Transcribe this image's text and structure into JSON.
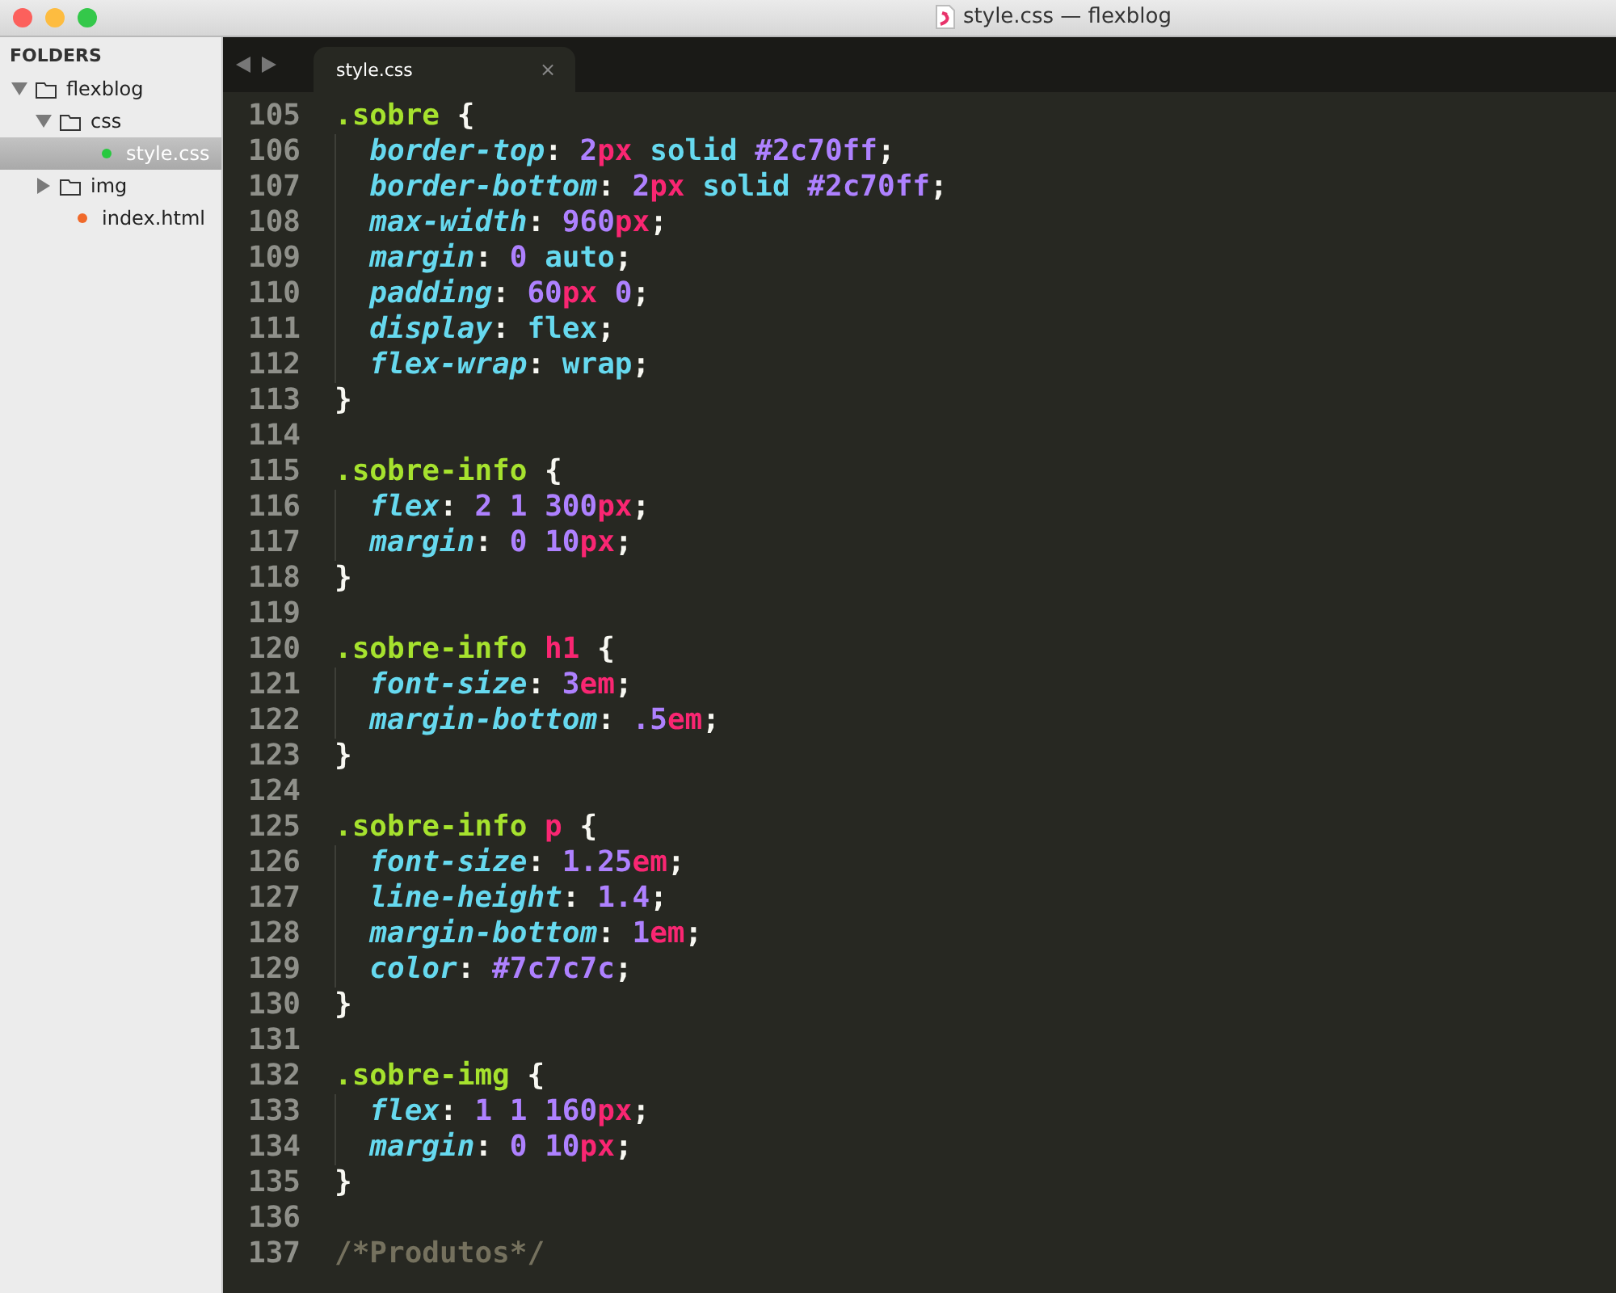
{
  "window": {
    "title": "style.css — flexblog"
  },
  "sidebar": {
    "heading": "FOLDERS",
    "items": [
      {
        "kind": "folder",
        "name": "flexblog",
        "expanded": true,
        "selected": false,
        "children": [
          {
            "kind": "folder",
            "name": "css",
            "expanded": true,
            "selected": false,
            "children": [
              {
                "kind": "file",
                "name": "style.css",
                "selected": true,
                "color": "#27c93f"
              }
            ]
          },
          {
            "kind": "folder",
            "name": "img",
            "expanded": false,
            "selected": false
          },
          {
            "kind": "file",
            "name": "index.html",
            "selected": false,
            "color": "#f0692a"
          }
        ]
      }
    ]
  },
  "tabs": [
    {
      "label": "style.css",
      "selected": true,
      "close": "×"
    }
  ],
  "editor": {
    "lines": [
      {
        "number": "105",
        "tokens": [
          {
            "kind": "selector",
            "text": ".sobre"
          },
          {
            "kind": "punct",
            "text": " {"
          }
        ]
      },
      {
        "number": "106",
        "tokens": [
          {
            "kind": "property",
            "text": "border-top"
          },
          {
            "kind": "punct",
            "text": ": "
          },
          {
            "kind": "number",
            "text": "2"
          },
          {
            "kind": "unit",
            "text": "px"
          },
          {
            "kind": "keyword",
            "text": " solid "
          },
          {
            "kind": "number",
            "text": "#2c70ff"
          },
          {
            "kind": "punct",
            "text": ";"
          }
        ]
      },
      {
        "number": "107",
        "tokens": [
          {
            "kind": "property",
            "text": "border-bottom"
          },
          {
            "kind": "punct",
            "text": ": "
          },
          {
            "kind": "number",
            "text": "2"
          },
          {
            "kind": "unit",
            "text": "px"
          },
          {
            "kind": "keyword",
            "text": " solid "
          },
          {
            "kind": "number",
            "text": "#2c70ff"
          },
          {
            "kind": "punct",
            "text": ";"
          }
        ]
      },
      {
        "number": "108",
        "tokens": [
          {
            "kind": "property",
            "text": "max-width"
          },
          {
            "kind": "punct",
            "text": ": "
          },
          {
            "kind": "number",
            "text": "960"
          },
          {
            "kind": "unit",
            "text": "px"
          },
          {
            "kind": "punct",
            "text": ";"
          }
        ]
      },
      {
        "number": "109",
        "tokens": [
          {
            "kind": "property",
            "text": "margin"
          },
          {
            "kind": "punct",
            "text": ": "
          },
          {
            "kind": "number",
            "text": "0"
          },
          {
            "kind": "keyword",
            "text": " auto"
          },
          {
            "kind": "punct",
            "text": ";"
          }
        ]
      },
      {
        "number": "110",
        "tokens": [
          {
            "kind": "property",
            "text": "padding"
          },
          {
            "kind": "punct",
            "text": ": "
          },
          {
            "kind": "number",
            "text": "60"
          },
          {
            "kind": "unit",
            "text": "px"
          },
          {
            "kind": "number",
            "text": " 0"
          },
          {
            "kind": "punct",
            "text": ";"
          }
        ]
      },
      {
        "number": "111",
        "tokens": [
          {
            "kind": "property",
            "text": "display"
          },
          {
            "kind": "punct",
            "text": ": "
          },
          {
            "kind": "keyword",
            "text": "flex"
          },
          {
            "kind": "punct",
            "text": ";"
          }
        ]
      },
      {
        "number": "112",
        "tokens": [
          {
            "kind": "property",
            "text": "flex-wrap"
          },
          {
            "kind": "punct",
            "text": ": "
          },
          {
            "kind": "keyword",
            "text": "wrap"
          },
          {
            "kind": "punct",
            "text": ";"
          }
        ]
      },
      {
        "number": "113",
        "tokens": [
          {
            "kind": "punct",
            "text": "}"
          }
        ]
      },
      {
        "number": "114"
      },
      {
        "number": "115",
        "tokens": [
          {
            "kind": "selector",
            "text": ".sobre-info"
          },
          {
            "kind": "punct",
            "text": " {"
          }
        ]
      },
      {
        "number": "116",
        "tokens": [
          {
            "kind": "property",
            "text": "flex"
          },
          {
            "kind": "punct",
            "text": ": "
          },
          {
            "kind": "number",
            "text": "2 1 300"
          },
          {
            "kind": "unit",
            "text": "px"
          },
          {
            "kind": "punct",
            "text": ";"
          }
        ]
      },
      {
        "number": "117",
        "tokens": [
          {
            "kind": "property",
            "text": "margin"
          },
          {
            "kind": "punct",
            "text": ": "
          },
          {
            "kind": "number",
            "text": "0 10"
          },
          {
            "kind": "unit",
            "text": "px"
          },
          {
            "kind": "punct",
            "text": ";"
          }
        ]
      },
      {
        "number": "118",
        "tokens": [
          {
            "kind": "punct",
            "text": "}"
          }
        ]
      },
      {
        "number": "119"
      },
      {
        "number": "120",
        "tokens": [
          {
            "kind": "selector",
            "text": ".sobre-info"
          },
          {
            "kind": "tag",
            "text": "h1"
          },
          {
            "kind": "punct",
            "text": " {"
          }
        ]
      },
      {
        "number": "121",
        "tokens": [
          {
            "kind": "property",
            "text": "font-size"
          },
          {
            "kind": "punct",
            "text": ": "
          },
          {
            "kind": "number",
            "text": "3"
          },
          {
            "kind": "unit",
            "text": "em"
          },
          {
            "kind": "punct",
            "text": ";"
          }
        ]
      },
      {
        "number": "122",
        "tokens": [
          {
            "kind": "property",
            "text": "margin-bottom"
          },
          {
            "kind": "punct",
            "text": ": "
          },
          {
            "kind": "number",
            "text": ".5"
          },
          {
            "kind": "unit",
            "text": "em"
          },
          {
            "kind": "punct",
            "text": ";"
          }
        ]
      },
      {
        "number": "123",
        "tokens": [
          {
            "kind": "punct",
            "text": "}"
          }
        ]
      },
      {
        "number": "124"
      },
      {
        "number": "125",
        "tokens": [
          {
            "kind": "selector",
            "text": ".sobre-info"
          },
          {
            "kind": "tag",
            "text": "p"
          },
          {
            "kind": "punct",
            "text": " {"
          }
        ]
      },
      {
        "number": "126",
        "tokens": [
          {
            "kind": "property",
            "text": "font-size"
          },
          {
            "kind": "punct",
            "text": ": "
          },
          {
            "kind": "number",
            "text": "1.25"
          },
          {
            "kind": "unit",
            "text": "em"
          },
          {
            "kind": "punct",
            "text": ";"
          }
        ]
      },
      {
        "number": "127",
        "tokens": [
          {
            "kind": "property",
            "text": "line-height"
          },
          {
            "kind": "punct",
            "text": ": "
          },
          {
            "kind": "number",
            "text": "1.4"
          },
          {
            "kind": "punct",
            "text": ";"
          }
        ]
      },
      {
        "number": "128",
        "tokens": [
          {
            "kind": "property",
            "text": "margin-bottom"
          },
          {
            "kind": "punct",
            "text": ": "
          },
          {
            "kind": "number",
            "text": "1"
          },
          {
            "kind": "unit",
            "text": "em"
          },
          {
            "kind": "punct",
            "text": ";"
          }
        ]
      },
      {
        "number": "129",
        "tokens": [
          {
            "kind": "property",
            "text": "color"
          },
          {
            "kind": "punct",
            "text": ": "
          },
          {
            "kind": "number",
            "text": "#7c7c7c"
          },
          {
            "kind": "punct",
            "text": ";"
          }
        ]
      },
      {
        "number": "130",
        "tokens": [
          {
            "kind": "punct",
            "text": "}"
          }
        ]
      },
      {
        "number": "131"
      },
      {
        "number": "132",
        "tokens": [
          {
            "kind": "selector",
            "text": ".sobre-img"
          },
          {
            "kind": "punct",
            "text": " {"
          }
        ]
      },
      {
        "number": "133",
        "tokens": [
          {
            "kind": "property",
            "text": "flex"
          },
          {
            "kind": "punct",
            "text": ": "
          },
          {
            "kind": "number",
            "text": "1 1 160"
          },
          {
            "kind": "unit",
            "text": "px"
          },
          {
            "kind": "punct",
            "text": ";"
          }
        ]
      },
      {
        "number": "134",
        "tokens": [
          {
            "kind": "property",
            "text": "margin"
          },
          {
            "kind": "punct",
            "text": ": "
          },
          {
            "kind": "number",
            "text": "0 10"
          },
          {
            "kind": "unit",
            "text": "px"
          },
          {
            "kind": "punct",
            "text": ";"
          }
        ]
      },
      {
        "number": "135",
        "tokens": [
          {
            "kind": "punct",
            "text": "}"
          }
        ]
      },
      {
        "number": "136"
      },
      {
        "number": "137",
        "tokens": [
          {
            "kind": "comment",
            "text": "/*Produtos*/"
          }
        ]
      }
    ]
  }
}
